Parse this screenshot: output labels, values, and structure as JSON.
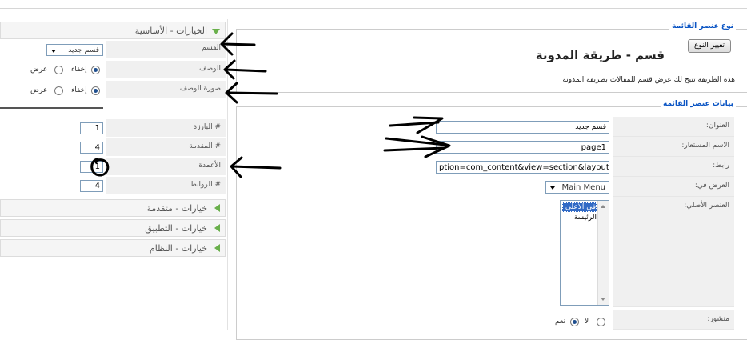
{
  "menu_item_type": {
    "legend": "نوع عنصر القائمة",
    "change_type_button": "تغيير النوع",
    "title": "قسم - طريقة المدونة",
    "description": "هذه الطريقة تتيح لك عرض قسم للمقالات بطريقة المدونة"
  },
  "menu_item_details": {
    "legend": "بيانات عنصر القائمة",
    "fields": {
      "title_label": "العنوان:",
      "title_value": "قسم جديد",
      "alias_label": "الاسم المستعار:",
      "alias_value": "page1",
      "link_label": "رابط:",
      "link_value": "ption=com_content&view=section&layout=blog",
      "display_in_label": "العرض في:",
      "display_in_value": "Main Menu",
      "parent_label": "العنصر الأصلي:",
      "parent_options": [
        "في الأعلى",
        "الرئيسة"
      ],
      "published_label": "منشور:",
      "published_options": [
        "لا",
        "نعم"
      ],
      "published_selected": "نعم"
    }
  },
  "params": {
    "basic_header": "الخيارات - الأساسية",
    "section_label": "القسم",
    "section_value": "قسم جديد",
    "description_label": "الوصف",
    "description_image_label": "صورة الوصف",
    "hide_label": "إخفاء",
    "show_label": "عرض",
    "description_selected": "إخفاء",
    "description_image_selected": "إخفاء",
    "leading_label": "# البارزة",
    "leading_value": "1",
    "intro_label": "# المقدمة",
    "intro_value": "4",
    "columns_label": "الأعمدة",
    "columns_value": "1",
    "links_label": "# الروابط",
    "links_value": "4",
    "advanced_header": "خيارات - متقدمة",
    "component_header": "خيارات - التطبيق",
    "system_header": "خيارات - النظام"
  },
  "colors": {
    "legend": "#0b55c4",
    "accent_green": "#6ab04c",
    "selection": "#316ac5"
  }
}
